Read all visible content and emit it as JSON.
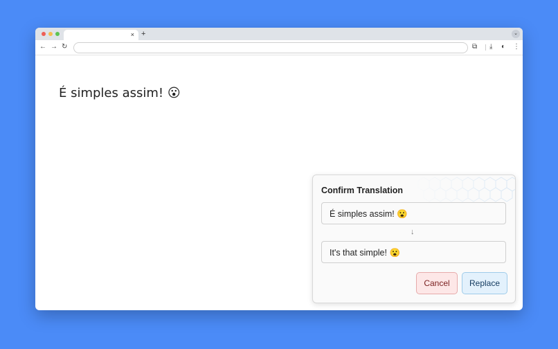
{
  "browser": {
    "new_tab_label": "+",
    "tab_close_label": "×",
    "tab_menu_label": "⌄",
    "nav": {
      "back": "←",
      "forward": "→",
      "reload": "↻"
    },
    "toolbar_icons": {
      "extensions": "⧉",
      "download": "⤓",
      "profile": "◐",
      "menu": "⋮"
    }
  },
  "page": {
    "text": "É simples assim! 😮"
  },
  "popup": {
    "title": "Confirm Translation",
    "source_text": "É simples assim! 😮",
    "arrow": "↓",
    "translated_text": "It's that simple! 😮",
    "cancel_label": "Cancel",
    "replace_label": "Replace"
  }
}
